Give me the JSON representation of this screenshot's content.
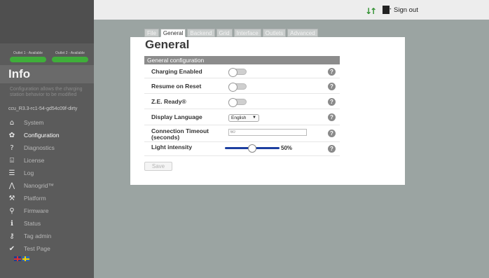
{
  "sidebar": {
    "outlets": [
      {
        "label": "Outlet 1 - Available",
        "status_color": "#3fae3a"
      },
      {
        "label": "Outlet 2 - Available",
        "status_color": "#3fae3a"
      }
    ],
    "info_title": "Info",
    "info_description": "Configuration allows the charging station behavior to be modified",
    "version": "ccu_R3.3-rc1-54-gd54c09f-dirty",
    "nav": [
      {
        "label": "System",
        "icon": "home-icon"
      },
      {
        "label": "Configuration",
        "icon": "gear-icon",
        "active": true
      },
      {
        "label": "Diagnostics",
        "icon": "question-icon"
      },
      {
        "label": "License",
        "icon": "lock-icon"
      },
      {
        "label": "Log",
        "icon": "list-icon"
      },
      {
        "label": "Nanogrid™",
        "icon": "graph-icon"
      },
      {
        "label": "Platform",
        "icon": "wrench-icon"
      },
      {
        "label": "Firmware",
        "icon": "chip-icon"
      },
      {
        "label": "Status",
        "icon": "info-icon"
      },
      {
        "label": "Tag admin",
        "icon": "key-icon"
      },
      {
        "label": "Test Page",
        "icon": "check-icon"
      }
    ],
    "languages": [
      "English",
      "Svenska"
    ]
  },
  "topbar": {
    "transfer_icon": "up-down-arrows-icon",
    "signout_label": "Sign out"
  },
  "tabs": [
    "File",
    "General",
    "Backend",
    "Grid",
    "Interface",
    "Outlets",
    "Advanced"
  ],
  "active_tab": "General",
  "main": {
    "title": "General",
    "section_title": "General configuration",
    "charging_enabled_label": "Charging Enabled",
    "charging_enabled_value": false,
    "resume_on_reset_label": "Resume on Reset",
    "resume_on_reset_value": false,
    "ze_ready_label": "Z.E. Ready®",
    "ze_ready_value": false,
    "display_language_label": "Display Language",
    "display_language_value": "English",
    "connection_timeout_label": "Connection Timeout (seconds)",
    "connection_timeout_value": "60",
    "light_intensity_label": "Light intensity",
    "light_intensity_value": "50%",
    "light_intensity_fraction": 0.5,
    "help_glyph": "?",
    "save_label": "Save"
  },
  "colors": {
    "background": "#9ba4a2",
    "sidebar": "#5b5b5b",
    "status_green": "#3fae3a",
    "slider_blue": "#1d3fa0"
  }
}
